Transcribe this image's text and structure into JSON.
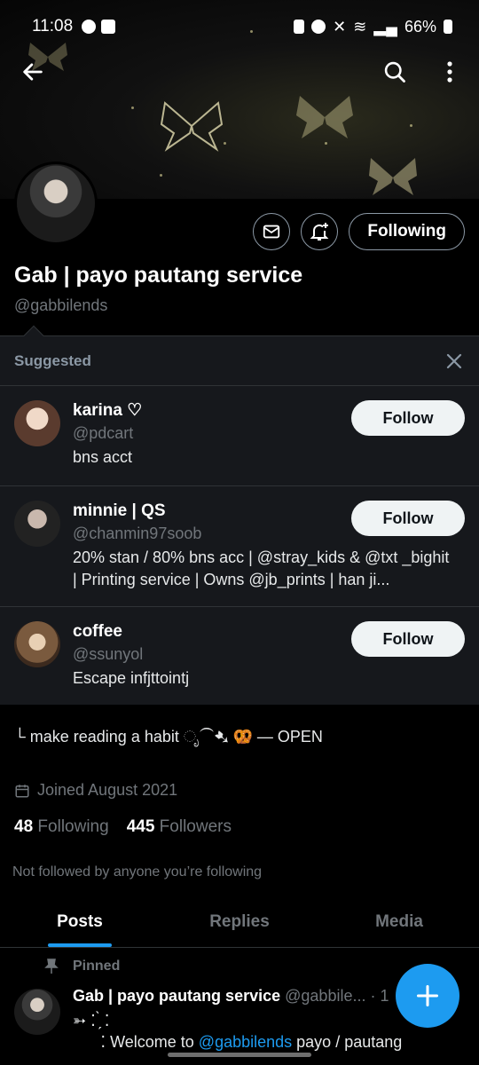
{
  "status_bar": {
    "time": "11:08",
    "battery": "66%"
  },
  "profile": {
    "display_name": "Gab | payo pautang service",
    "handle": "@gabbilends",
    "following_button": "Following",
    "bio": "└ make reading a habit ೃ⁀➷ 🥨 — OPEN",
    "joined": "Joined August 2021",
    "following_count": "48",
    "following_label": "Following",
    "followers_count": "445",
    "followers_label": "Followers",
    "not_followed": "Not followed by anyone you’re following"
  },
  "suggested": {
    "title": "Suggested",
    "items": [
      {
        "name": "karina ♡",
        "handle": "@pdcart",
        "bio": "bns acct",
        "button": "Follow"
      },
      {
        "name": "minnie | QS",
        "handle": "@chanmin97soob",
        "bio": "20% stan / 80% bns acc | @stray_kids & @txt _bighit | Printing service | Owns @jb_prints | han ji...",
        "button": "Follow"
      },
      {
        "name": "coffee",
        "handle": "@ssunyol",
        "bio": "Escape infjttointj",
        "button": "Follow"
      }
    ]
  },
  "tabs": [
    {
      "label": "Posts",
      "active": true
    },
    {
      "label": "Replies",
      "active": false
    },
    {
      "label": "Media",
      "active": false
    }
  ],
  "post": {
    "pinned_label": "Pinned",
    "author": "Gab | payo pautang service",
    "handle": "@gabbile...",
    "meta": "· 1",
    "line1": "➳ ⁚ ̗̀ ⁚",
    "line2_prefix": "⠀⠀ ⁚ Welcome to ",
    "line2_link": "@gabbilends",
    "line2_suffix": " payo / pautang"
  },
  "colors": {
    "accent": "#1d9bf0",
    "background": "#000000",
    "panel": "#16181c"
  },
  "icons": [
    "back-arrow-icon",
    "search-icon",
    "more-vertical-icon",
    "mail-icon",
    "bell-plus-icon",
    "close-icon",
    "calendar-icon",
    "pin-icon",
    "compose-plus-icon"
  ]
}
